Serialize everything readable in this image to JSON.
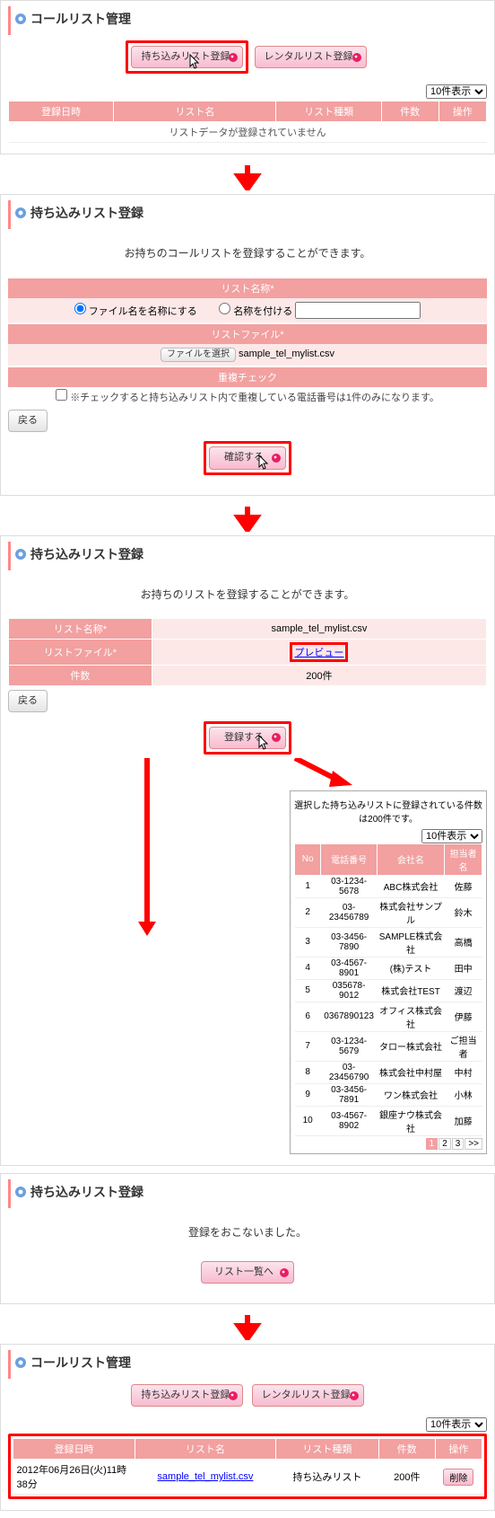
{
  "sections": {
    "s1": {
      "title": "コールリスト管理",
      "btn_import": "持ち込みリスト登録",
      "btn_rental": "レンタルリスト登録",
      "select_pagesize": "10件表示",
      "headers": [
        "登録日時",
        "リスト名",
        "リスト種類",
        "件数",
        "操作"
      ],
      "empty_msg": "リストデータが登録されていません"
    },
    "s2": {
      "title": "持ち込みリスト登録",
      "lead": "お持ちのコールリストを登録することができます。",
      "band_listname": "リスト名称*",
      "radio_usefile": "ファイル名を名称にする",
      "radio_rename": "名称を付ける",
      "band_listfile": "リストファイル*",
      "btn_choose": "ファイルを選択",
      "filename": "sample_tel_mylist.csv",
      "band_dup": "重複チェック",
      "dup_note": "※チェックすると持ち込みリスト内で重複している電話番号は1件のみになります。",
      "btn_back": "戻る",
      "btn_confirm": "確認する"
    },
    "s3": {
      "title": "持ち込みリスト登録",
      "lead": "お持ちのリストを登録することができます。",
      "row_name_label": "リスト名称*",
      "row_name_val": "sample_tel_mylist.csv",
      "row_file_label": "リストファイル*",
      "row_file_val": "プレビュー",
      "row_count_label": "件数",
      "row_count_val": "200件",
      "btn_back": "戻る",
      "btn_submit": "登録する"
    },
    "preview": {
      "msg": "選択した持ち込みリストに登録されている件数は200件です。",
      "select_pagesize": "10件表示",
      "headers": [
        "No",
        "電話番号",
        "会社名",
        "担当者名"
      ],
      "rows": [
        [
          "1",
          "03-1234-5678",
          "ABC株式会社",
          "佐藤"
        ],
        [
          "2",
          "03-23456789",
          "株式会社サンプル",
          "鈴木"
        ],
        [
          "3",
          "03-3456-7890",
          "SAMPLE株式会社",
          "高橋"
        ],
        [
          "4",
          "03-4567-8901",
          "(株)テスト",
          "田中"
        ],
        [
          "5",
          "035678-9012",
          "株式会社TEST",
          "渡辺"
        ],
        [
          "6",
          "0367890123",
          "オフィス株式会社",
          "伊藤"
        ],
        [
          "7",
          "03-1234-5679",
          "タロー株式会社",
          "ご担当者"
        ],
        [
          "8",
          "03-23456790",
          "株式会社中村屋",
          "中村"
        ],
        [
          "9",
          "03-3456-7891",
          "ワン株式会社",
          "小林"
        ],
        [
          "10",
          "03-4567-8902",
          "銀座ナウ株式会社",
          "加藤"
        ]
      ],
      "pages": [
        "1",
        "2",
        "3",
        ">>"
      ]
    },
    "s4": {
      "title": "持ち込みリスト登録",
      "done_msg": "登録をおこないました。",
      "btn_tolist": "リスト一覧へ"
    },
    "s5": {
      "title": "コールリスト管理",
      "btn_import": "持ち込みリスト登録",
      "btn_rental": "レンタルリスト登録",
      "select_pagesize": "10件表示",
      "headers": [
        "登録日時",
        "リスト名",
        "リスト種類",
        "件数",
        "操作"
      ],
      "row": {
        "date": "2012年06月26日(火)11時38分",
        "name": "sample_tel_mylist.csv",
        "type": "持ち込みリスト",
        "count": "200件",
        "del": "削除"
      }
    }
  }
}
